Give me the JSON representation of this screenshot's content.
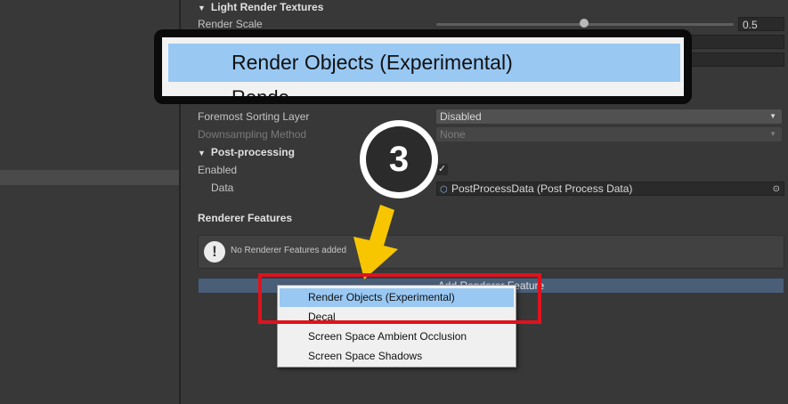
{
  "inspector": {
    "light_textures_header": "Light Render Textures",
    "render_scale_label": "Render Scale",
    "render_scale_value": "0.5",
    "render_scale_fraction": 0.5,
    "foremost_label": "Foremost Sorting Layer",
    "foremost_value": "Disabled",
    "downsampling_label": "Downsampling Method",
    "downsampling_value": "None",
    "postprocessing_header": "Post-processing",
    "enabled_label": "Enabled",
    "enabled_checked": true,
    "data_label": "Data",
    "data_value": "PostProcessData (Post Process Data)",
    "renderer_features_header": "Renderer Features",
    "no_features_text": "No Renderer Features added",
    "add_feature_label": "Add Renderer Feature"
  },
  "zoom_callout": {
    "item_label": "Render Objects (Experimental)",
    "peek_label": "Rende"
  },
  "step_badge": {
    "number": "3"
  },
  "context_menu": {
    "items": [
      {
        "label": "Render Objects (Experimental)",
        "selected": true
      },
      {
        "label": "Decal",
        "selected": false
      },
      {
        "label": "Screen Space Ambient Occlusion",
        "selected": false
      },
      {
        "label": "Screen Space Shadows",
        "selected": false
      }
    ]
  },
  "colors": {
    "background": "#383838",
    "menu_highlight": "#99c8f3",
    "highlight_border": "#e0121d",
    "arrow": "#f7c600",
    "button": "#4a5e78"
  }
}
